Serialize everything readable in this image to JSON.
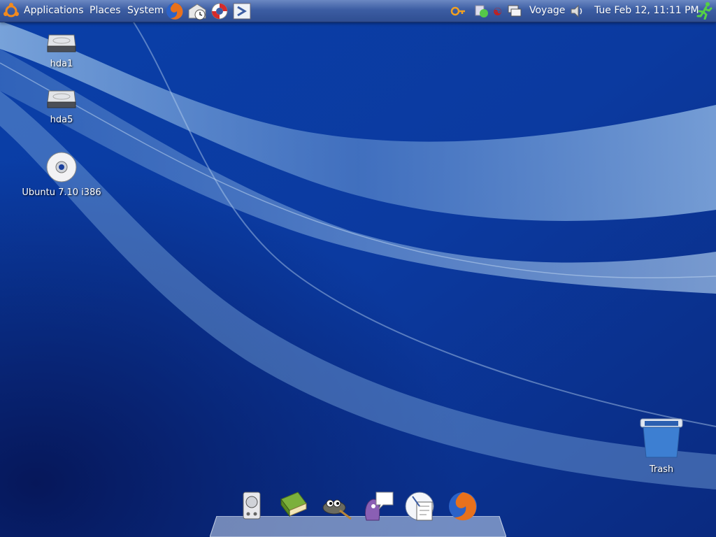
{
  "panel": {
    "menus": [
      "Applications",
      "Places",
      "System"
    ],
    "launchers": [
      "firefox-icon",
      "evolution-mail-icon",
      "help-lifebuoy-icon",
      "remote-desktop-icon"
    ],
    "tray": [
      "key-exit-icon",
      "notification-icon",
      "input-method-icon",
      "network-icon"
    ],
    "user": "Voyage",
    "clock": "Tue Feb 12, 11:11 PM"
  },
  "desktop": {
    "icons": [
      {
        "label": "hda1",
        "icon": "harddisk-icon"
      },
      {
        "label": "hda5",
        "icon": "harddisk-icon"
      },
      {
        "label": "Ubuntu 7.10 i386",
        "icon": "cdrom-icon"
      },
      {
        "label": "Trash",
        "icon": "trash-icon"
      }
    ]
  },
  "dock": {
    "items": [
      "drive-icon",
      "books-icon",
      "gimp-icon",
      "pidgin-icon",
      "clock-document-icon",
      "firefox-icon"
    ]
  },
  "colors": {
    "wallpaper_dark": "#071f6e",
    "wallpaper_mid": "#0b46b5",
    "wallpaper_light": "#8ab4e0",
    "panel": "#3c5da3"
  }
}
